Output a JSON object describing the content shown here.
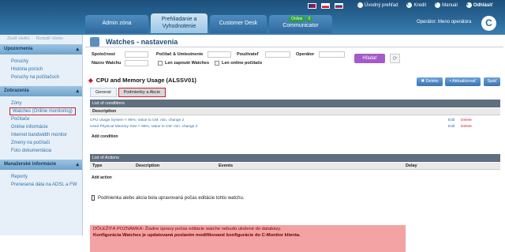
{
  "header": {
    "toplinks": [
      "Úvodný prehľad",
      "Kredit",
      "Manuál",
      "Odhlásiť"
    ],
    "tabs": [
      {
        "label": "Admin zóna"
      },
      {
        "label": "Prehliadanie a Vyhodnotenie"
      },
      {
        "label": "Customer Desk"
      },
      {
        "label": "Communicator"
      }
    ],
    "online_badge": "Online",
    "online_count": "0",
    "operator": "Operátor: Meno operátora",
    "logo_letter": "C"
  },
  "sidebar": {
    "top_links": [
      "Zbaliť všetko",
      "Rozbaliť všetko"
    ],
    "sections": [
      {
        "title": "Upozornenia",
        "items": [
          "Poruchy",
          "História porúch",
          "Poruchy na počítačoch"
        ]
      },
      {
        "title": "Zobrazenia",
        "items": [
          "Zóny",
          "Watches (Online monitoring)",
          "Počítače",
          "Online informácie",
          "Internet bandwidth monitor",
          "Zmeny na počítači",
          "Foto dokumentácia"
        ]
      },
      {
        "title": "Manažerské informácie",
        "items": [
          "Reporty",
          "Prenesená dáta na ADSL a FW"
        ]
      }
    ]
  },
  "main": {
    "title": "Watches - nastavenia",
    "filters": {
      "spolocnost": "Spoločnost",
      "pocitac": "Počítač & Umiestnenie",
      "pouzivatel": "Používateľ",
      "operator": "Operátor",
      "nazov": "Názov Watchu",
      "len_zapnute": "Len zapnuté Watches",
      "len_online": "Len online počítače",
      "hladat": "Hľadať"
    },
    "watch_name": "CPU and Memory Usage (ALSSV01)",
    "buttons": {
      "delete": "Delete",
      "update": "Aktualizovať",
      "back": "Späť"
    },
    "subtabs": [
      "General",
      "Podmienky a Akcie"
    ],
    "conditions": {
      "header": "List of conditions",
      "col": "Description",
      "rows": [
        {
          "text": "CPU Usage System < 96%; Value to CM: min. change 2",
          "edit": "Edit",
          "del": "Delete"
        },
        {
          "text": "Used Physical Memory Size < 96%; Value to CM: min. change 2",
          "edit": "Edit",
          "del": "Delete"
        }
      ],
      "add": "Add condition"
    },
    "actions": {
      "header": "List of Actions",
      "cols": [
        "Type",
        "Description",
        "Events",
        "Delay"
      ],
      "add": "Add action"
    },
    "note": "Podmienka alebo akcia bola upravovaná počas editácie tohto watchu.",
    "warning": {
      "head": "DÔLEŽITÁ POZNÁMKA: Žiadne úpravy počas editácie watche nebudú uložené do databázy.",
      "body": "Konfigurácia Watches je updatovaná poslaním modifikované konfigurácie do C-Monitor klienta."
    }
  },
  "colors": {
    "accent": "#2b6a9a",
    "danger": "#c42030",
    "warn_bg": "#f3a3a3",
    "search_btn": "#a45bc7"
  }
}
